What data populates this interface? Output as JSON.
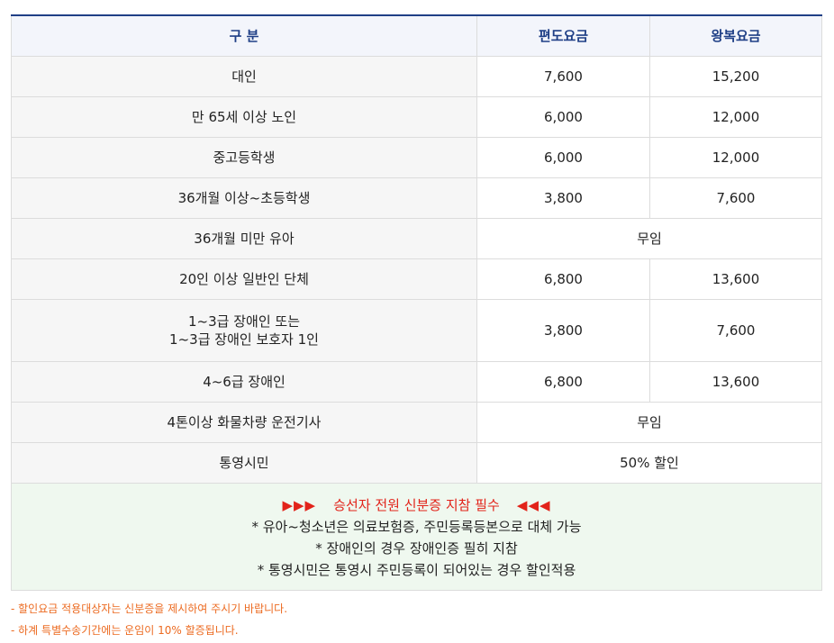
{
  "header": {
    "category": "구 분",
    "one_way": "편도요금",
    "round_trip": "왕복요금"
  },
  "rows": [
    {
      "label": "대인",
      "one_way": "7,600",
      "round_trip": "15,200"
    },
    {
      "label": "만 65세 이상 노인",
      "one_way": "6,000",
      "round_trip": "12,000"
    },
    {
      "label": "중고등학생",
      "one_way": "6,000",
      "round_trip": "12,000"
    },
    {
      "label": "36개월 이상~초등학생",
      "one_way": "3,800",
      "round_trip": "7,600"
    },
    {
      "label": "36개월 미만 유아",
      "merged": "무임"
    },
    {
      "label": "20인 이상 일반인 단체",
      "one_way": "6,800",
      "round_trip": "13,600"
    },
    {
      "label_line1": "1~3급 장애인 또는",
      "label_line2": "1~3급 장애인 보호자 1인",
      "one_way": "3,800",
      "round_trip": "7,600"
    },
    {
      "label": "4~6급 장애인",
      "one_way": "6,800",
      "round_trip": "13,600"
    },
    {
      "label": "4톤이상 화물차량 운전기사",
      "merged": "무임"
    },
    {
      "label": "통영시민",
      "merged": "50% 할인"
    }
  ],
  "notice": {
    "arrows_left": "▶▶▶",
    "headline": "승선자 전원 신분증 지참 필수",
    "arrows_right": "◀◀◀",
    "line1": "* 유아~청소년은 의료보험증, 주민등록등본으로 대체 가능",
    "line2": "* 장애인의 경우 장애인증 필히 지참",
    "line3": "* 통영시민은 통영시 주민등록이 되어있는 경우 할인적용"
  },
  "footnotes": {
    "note1": "- 할인요금 적용대상자는 신분증을 제시하여 주시기 바랍니다.",
    "note2": "- 하계 특별수송기간에는 운임이 10% 할증됩니다."
  },
  "colors": {
    "header_text": "#1f3f86",
    "header_bg": "#f3f5fb",
    "notice_bg": "#eff8ef",
    "alert": "#e2231a",
    "footnote": "#ec6a20"
  }
}
